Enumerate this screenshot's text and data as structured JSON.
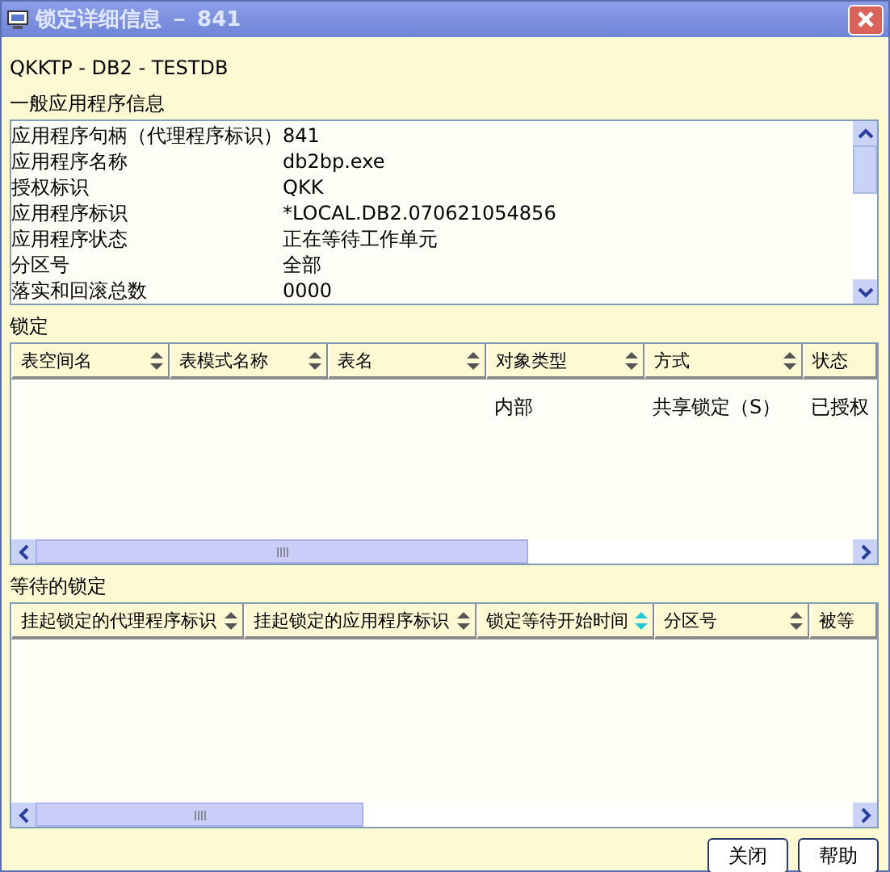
{
  "window": {
    "title": "锁定详细信息 － 841"
  },
  "heading": "QKKTP - DB2 - TESTDB",
  "general": {
    "label": "一般应用程序信息",
    "rows": [
      {
        "name": "应用程序句柄（代理程序标识）",
        "value": "841"
      },
      {
        "name": "应用程序名称",
        "value": "db2bp.exe"
      },
      {
        "name": "授权标识",
        "value": "QKK"
      },
      {
        "name": "应用程序标识",
        "value": "*LOCAL.DB2.070621054856"
      },
      {
        "name": "应用程序状态",
        "value": "正在等待工作单元"
      },
      {
        "name": "分区号",
        "value": "全部"
      },
      {
        "name": "落实和回滚总数",
        "value": "0000"
      }
    ]
  },
  "locks": {
    "label": "锁定",
    "columns": [
      {
        "label": "表空间名",
        "sorted": false
      },
      {
        "label": "表模式名称",
        "sorted": false
      },
      {
        "label": "表名",
        "sorted": false
      },
      {
        "label": "对象类型",
        "sorted": false
      },
      {
        "label": "方式",
        "sorted": false
      },
      {
        "label": "状态"
      }
    ],
    "rows": [
      [
        "",
        "",
        "",
        "内部",
        "共享锁定（S）",
        "已授权"
      ]
    ]
  },
  "waiting": {
    "label": "等待的锁定",
    "columns": [
      {
        "label": "挂起锁定的代理程序标识",
        "sorted": false
      },
      {
        "label": "挂起锁定的应用程序标识",
        "sorted": false
      },
      {
        "label": "锁定等待开始时间",
        "sorted": true
      },
      {
        "label": "分区号",
        "sorted": false
      },
      {
        "label": "被等"
      }
    ]
  },
  "buttons": [
    "关闭",
    "帮助"
  ]
}
